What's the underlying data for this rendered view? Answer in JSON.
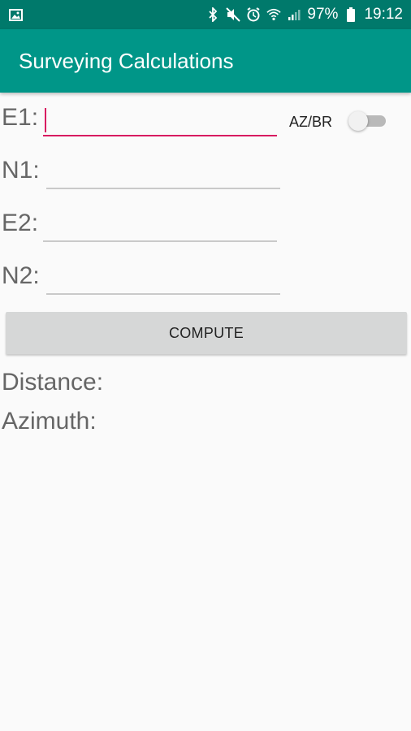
{
  "status_bar": {
    "left_icon": "image-icon",
    "icons": [
      "bluetooth-icon",
      "mute-icon",
      "alarm-icon",
      "wifi-icon",
      "signal-icon"
    ],
    "battery": "97%",
    "battery_icon": "battery-icon",
    "time": "19:12"
  },
  "app_bar": {
    "title": "Surveying Calculations",
    "color": "#009688"
  },
  "form": {
    "e1": {
      "label": "E1:",
      "value": ""
    },
    "n1": {
      "label": "N1:",
      "value": ""
    },
    "e2": {
      "label": "E2:",
      "value": ""
    },
    "n2": {
      "label": "N2:",
      "value": ""
    },
    "switch_label": "AZ/BR",
    "switch_on": false
  },
  "compute_label": "COMPUTE",
  "results": {
    "distance_label": "Distance:",
    "azimuth_label": "Azimuth:"
  },
  "colors": {
    "accent": "#d81b60",
    "status_bar": "#00796b"
  }
}
